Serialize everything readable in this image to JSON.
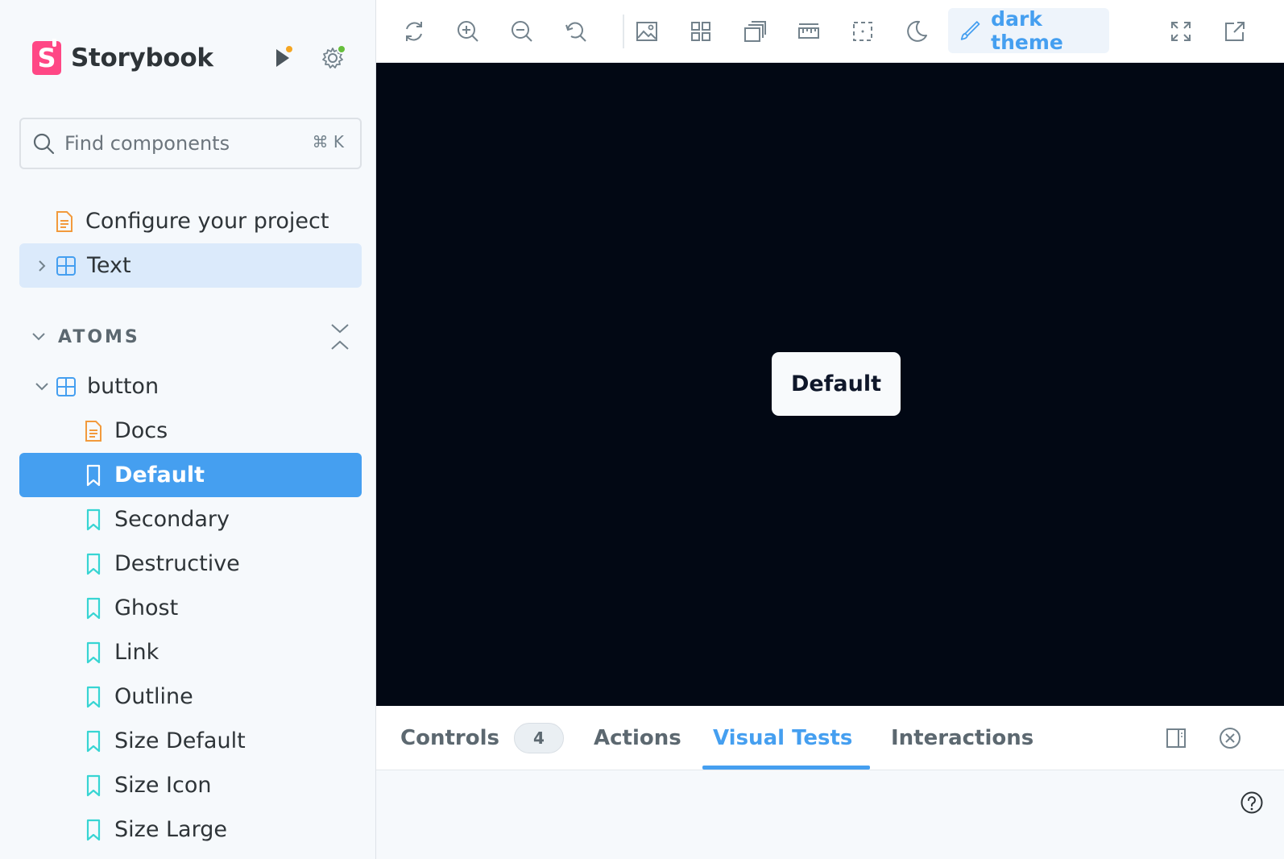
{
  "brand": {
    "name": "Storybook"
  },
  "search": {
    "placeholder": "Find components",
    "shortcut": "⌘ K"
  },
  "tree": {
    "top_items": [
      {
        "label": "Configure your project",
        "kind": "docs"
      },
      {
        "label": "Text",
        "kind": "component",
        "expanded": false
      }
    ],
    "section_label": "ATOMS",
    "component": {
      "label": "button",
      "expanded": true
    },
    "stories": [
      {
        "label": "Docs",
        "kind": "docs"
      },
      {
        "label": "Default",
        "kind": "story",
        "selected": true
      },
      {
        "label": "Secondary",
        "kind": "story"
      },
      {
        "label": "Destructive",
        "kind": "story"
      },
      {
        "label": "Ghost",
        "kind": "story"
      },
      {
        "label": "Link",
        "kind": "story"
      },
      {
        "label": "Outline",
        "kind": "story"
      },
      {
        "label": "Size Default",
        "kind": "story"
      },
      {
        "label": "Size Icon",
        "kind": "story"
      },
      {
        "label": "Size Large",
        "kind": "story"
      }
    ]
  },
  "toolbar": {
    "icons": [
      "remount-icon",
      "zoom-in-icon",
      "zoom-out-icon",
      "reset-zoom-icon",
      "background-icon",
      "grid-icon",
      "viewport-icon",
      "measure-icon",
      "outline-icon",
      "moon-icon",
      "fullscreen-icon",
      "open-new-tab-icon"
    ],
    "theme_label": "dark theme"
  },
  "canvas": {
    "background": "#020814",
    "button_label": "Default"
  },
  "panel": {
    "tabs": [
      {
        "label": "Controls",
        "badge": "4"
      },
      {
        "label": "Actions"
      },
      {
        "label": "Visual Tests",
        "active": true
      },
      {
        "label": "Interactions"
      }
    ]
  },
  "colors": {
    "accent": "#459ff0",
    "brand": "#ff4785",
    "docs_icon": "#f29a3c",
    "story_icon": "#37d5d3",
    "component_icon": "#459ff0"
  }
}
